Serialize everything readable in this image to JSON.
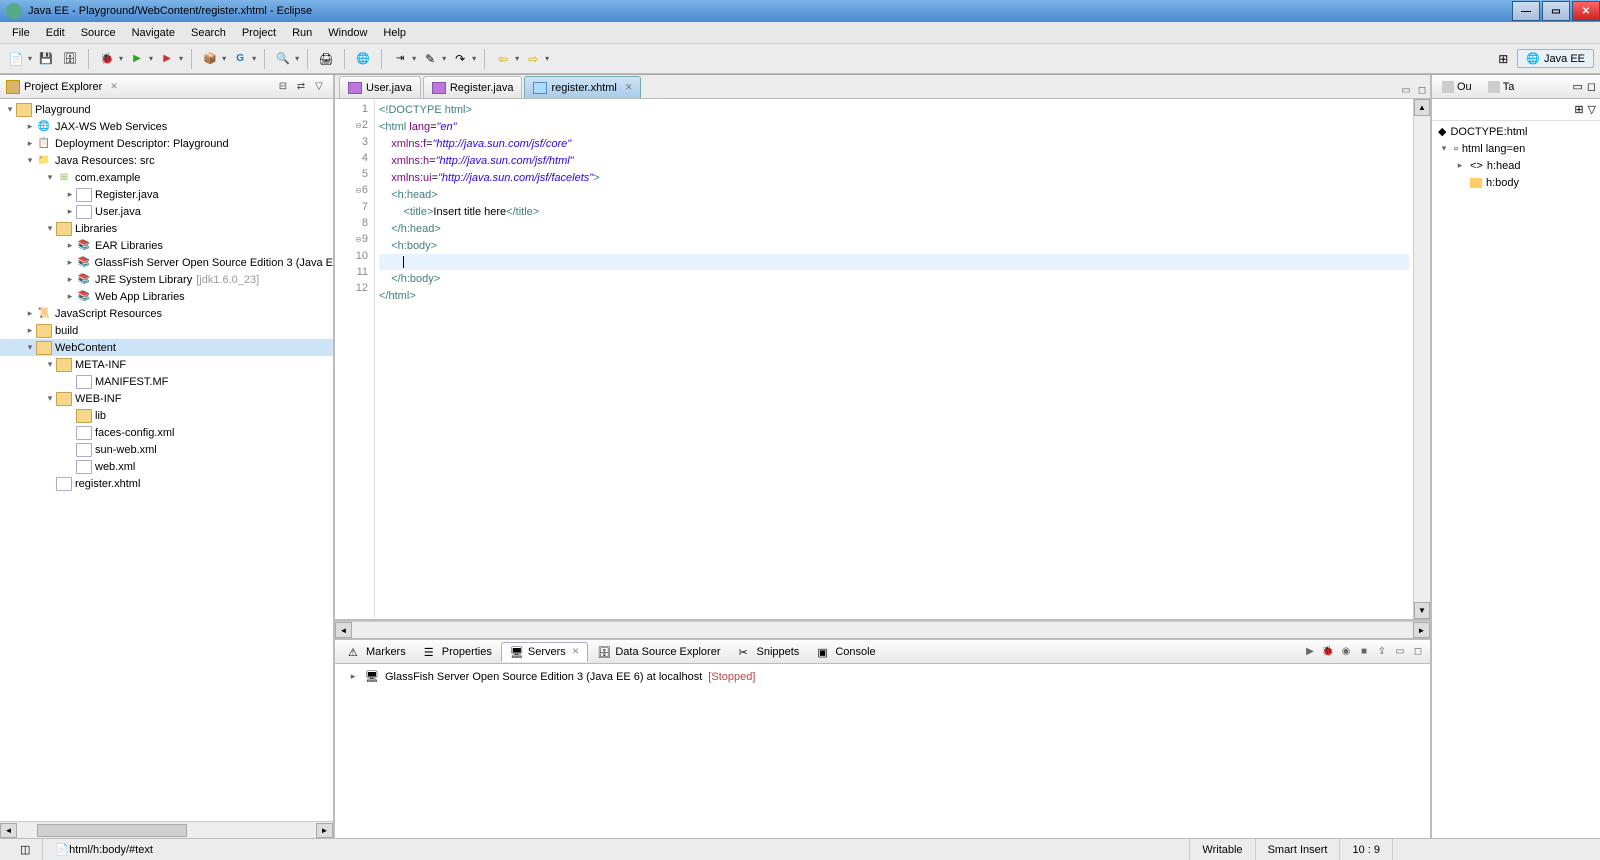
{
  "window": {
    "title": "Java EE - Playground/WebContent/register.xhtml - Eclipse"
  },
  "menu": {
    "items": [
      "File",
      "Edit",
      "Source",
      "Navigate",
      "Search",
      "Project",
      "Run",
      "Window",
      "Help"
    ]
  },
  "perspective": {
    "current": "Java EE"
  },
  "projectExplorer": {
    "title": "Project Explorer",
    "tree": {
      "project": "Playground",
      "jaxws": "JAX-WS Web Services",
      "dd": "Deployment Descriptor: Playground",
      "javares": "Java Resources: src",
      "pkg": "com.example",
      "reg": "Register.java",
      "user": "User.java",
      "libs": "Libraries",
      "ear": "EAR Libraries",
      "gf": "GlassFish Server Open Source Edition 3 (Java E",
      "jre": "JRE System Library",
      "jrever": "[jdk1.6.0_23]",
      "webapplibs": "Web App Libraries",
      "jsres": "JavaScript Resources",
      "build": "build",
      "webcontent": "WebContent",
      "metainf": "META-INF",
      "manifest": "MANIFEST.MF",
      "webinf": "WEB-INF",
      "lib": "lib",
      "faces": "faces-config.xml",
      "sunweb": "sun-web.xml",
      "webxml": "web.xml",
      "regx": "register.xhtml"
    }
  },
  "editorTabs": {
    "t1": "User.java",
    "t2": "Register.java",
    "t3": "register.xhtml"
  },
  "code": {
    "l1": "<!DOCTYPE html>",
    "l2a": "<html",
    "l2b": " lang",
    "l2c": "=",
    "l2d": "\"en\"",
    "l3a": "    xmlns:f",
    "l3b": "=",
    "l3c": "\"http://java.sun.com/jsf/core\"",
    "l4a": "    xmlns:h",
    "l4b": "=",
    "l4c": "\"http://java.sun.com/jsf/html\"",
    "l5a": "    xmlns:ui",
    "l5b": "=",
    "l5c": "\"http://java.sun.com/jsf/facelets\"",
    "l5d": ">",
    "l6": "    <h:head>",
    "l7a": "        <title>",
    "l7b": "Insert title here",
    "l7c": "</title>",
    "l8": "    </h:head>",
    "l9": "    <h:body>",
    "l10": "        ",
    "l11": "    </h:body>",
    "l12": "</html>"
  },
  "bottomTabs": {
    "markers": "Markers",
    "properties": "Properties",
    "servers": "Servers",
    "dse": "Data Source Explorer",
    "snippets": "Snippets",
    "console": "Console"
  },
  "server": {
    "name": "GlassFish Server Open Source Edition 3 (Java EE 6) at localhost",
    "state": "[Stopped]"
  },
  "outline": {
    "tab1": "Ou",
    "tab2": "Ta",
    "items": {
      "doctype": "DOCTYPE:html",
      "html": "html lang=en",
      "head": "h:head",
      "body": "h:body"
    }
  },
  "status": {
    "path": "html/h:body/#text",
    "writable": "Writable",
    "insert": "Smart Insert",
    "pos": "10 : 9"
  }
}
